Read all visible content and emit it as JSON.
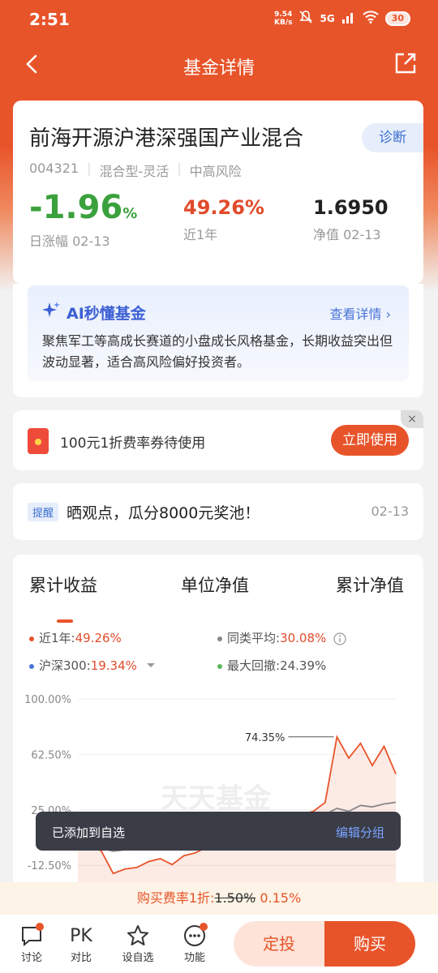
{
  "status": {
    "time": "2:51",
    "net_speed": "9.54\nKB/s",
    "network": "5G",
    "battery": "30"
  },
  "nav": {
    "title": "基金详情"
  },
  "fund": {
    "name": "前海开源沪港深强国产业混合",
    "diagnose": "诊断",
    "code": "004321",
    "type": "混合型-灵活",
    "risk": "中高风险",
    "daily_change": "-1.96",
    "daily_change_unit": "%",
    "daily_label": "日涨幅 02-13",
    "year_return": "49.26%",
    "year_label": "近1年",
    "nav_value": "1.6950",
    "nav_label": "净值 02-13"
  },
  "ai": {
    "title": "AI秒懂基金",
    "more": "查看详情 ›",
    "text": "聚焦军工等高成长赛道的小盘成长风格基金，长期收益突出但波动显著，适合高风险偏好投资者。"
  },
  "coupon": {
    "text": "100元1折费率券待使用",
    "button": "立即使用",
    "close": "×"
  },
  "remind": {
    "tag": "提醒",
    "text": "晒观点，瓜分8000元奖池！",
    "date": "02-13"
  },
  "chart_tabs": [
    "累计收益",
    "单位净值",
    "累计净值"
  ],
  "legend": {
    "l1_label": "近1年:",
    "l1_value": "49.26%",
    "l2_label": "同类平均:",
    "l2_value": "30.08%",
    "l3_label": "沪深300:",
    "l3_value": "19.34%",
    "l4_label": "最大回撤:",
    "l4_value": "24.39%"
  },
  "chart_data": {
    "type": "line",
    "yticks": [
      "100.00%",
      "62.50%",
      "25.00%",
      "-12.50%"
    ],
    "ylim": [
      -25,
      100
    ],
    "annotation": "74.35%",
    "watermark": "天天基金",
    "series": [
      {
        "name": "近1年",
        "color": "#e8542a",
        "values": [
          0,
          2,
          -3,
          -18,
          -15,
          -14,
          -10,
          -8,
          -12,
          -6,
          -4,
          0,
          3,
          8,
          6,
          12,
          10,
          14,
          16,
          22,
          24,
          30,
          74.35,
          60,
          70,
          55,
          68,
          49.26
        ]
      },
      {
        "name": "同类平均",
        "color": "#888888",
        "values": [
          0,
          1,
          -1,
          -3,
          -2,
          0,
          1,
          2,
          0,
          3,
          4,
          5,
          7,
          9,
          8,
          10,
          11,
          13,
          14,
          16,
          18,
          22,
          26,
          24,
          28,
          27,
          29,
          30.08
        ]
      },
      {
        "name": "沪深300",
        "color": "#4a74d8",
        "values": [
          0,
          -1,
          1,
          -2,
          -1,
          0,
          2,
          1,
          3,
          2,
          4,
          6,
          5,
          7,
          9,
          8,
          10,
          12,
          11,
          13,
          14,
          16,
          18,
          17,
          19,
          18,
          20,
          19.34
        ]
      }
    ]
  },
  "toast": {
    "text": "已添加到自选",
    "action": "编辑分组"
  },
  "fee": {
    "prefix": "购买费率1折:",
    "original": "1.50%",
    "discounted": "0.15%"
  },
  "bottom": {
    "discuss": "讨论",
    "pk": "PK",
    "compare": "对比",
    "watch": "设自选",
    "function": "功能",
    "fixed_invest": "定投",
    "buy": "购买"
  },
  "colors": {
    "accent": "#e8542a",
    "down": "#3aa13d",
    "up": "#e14b2a"
  }
}
